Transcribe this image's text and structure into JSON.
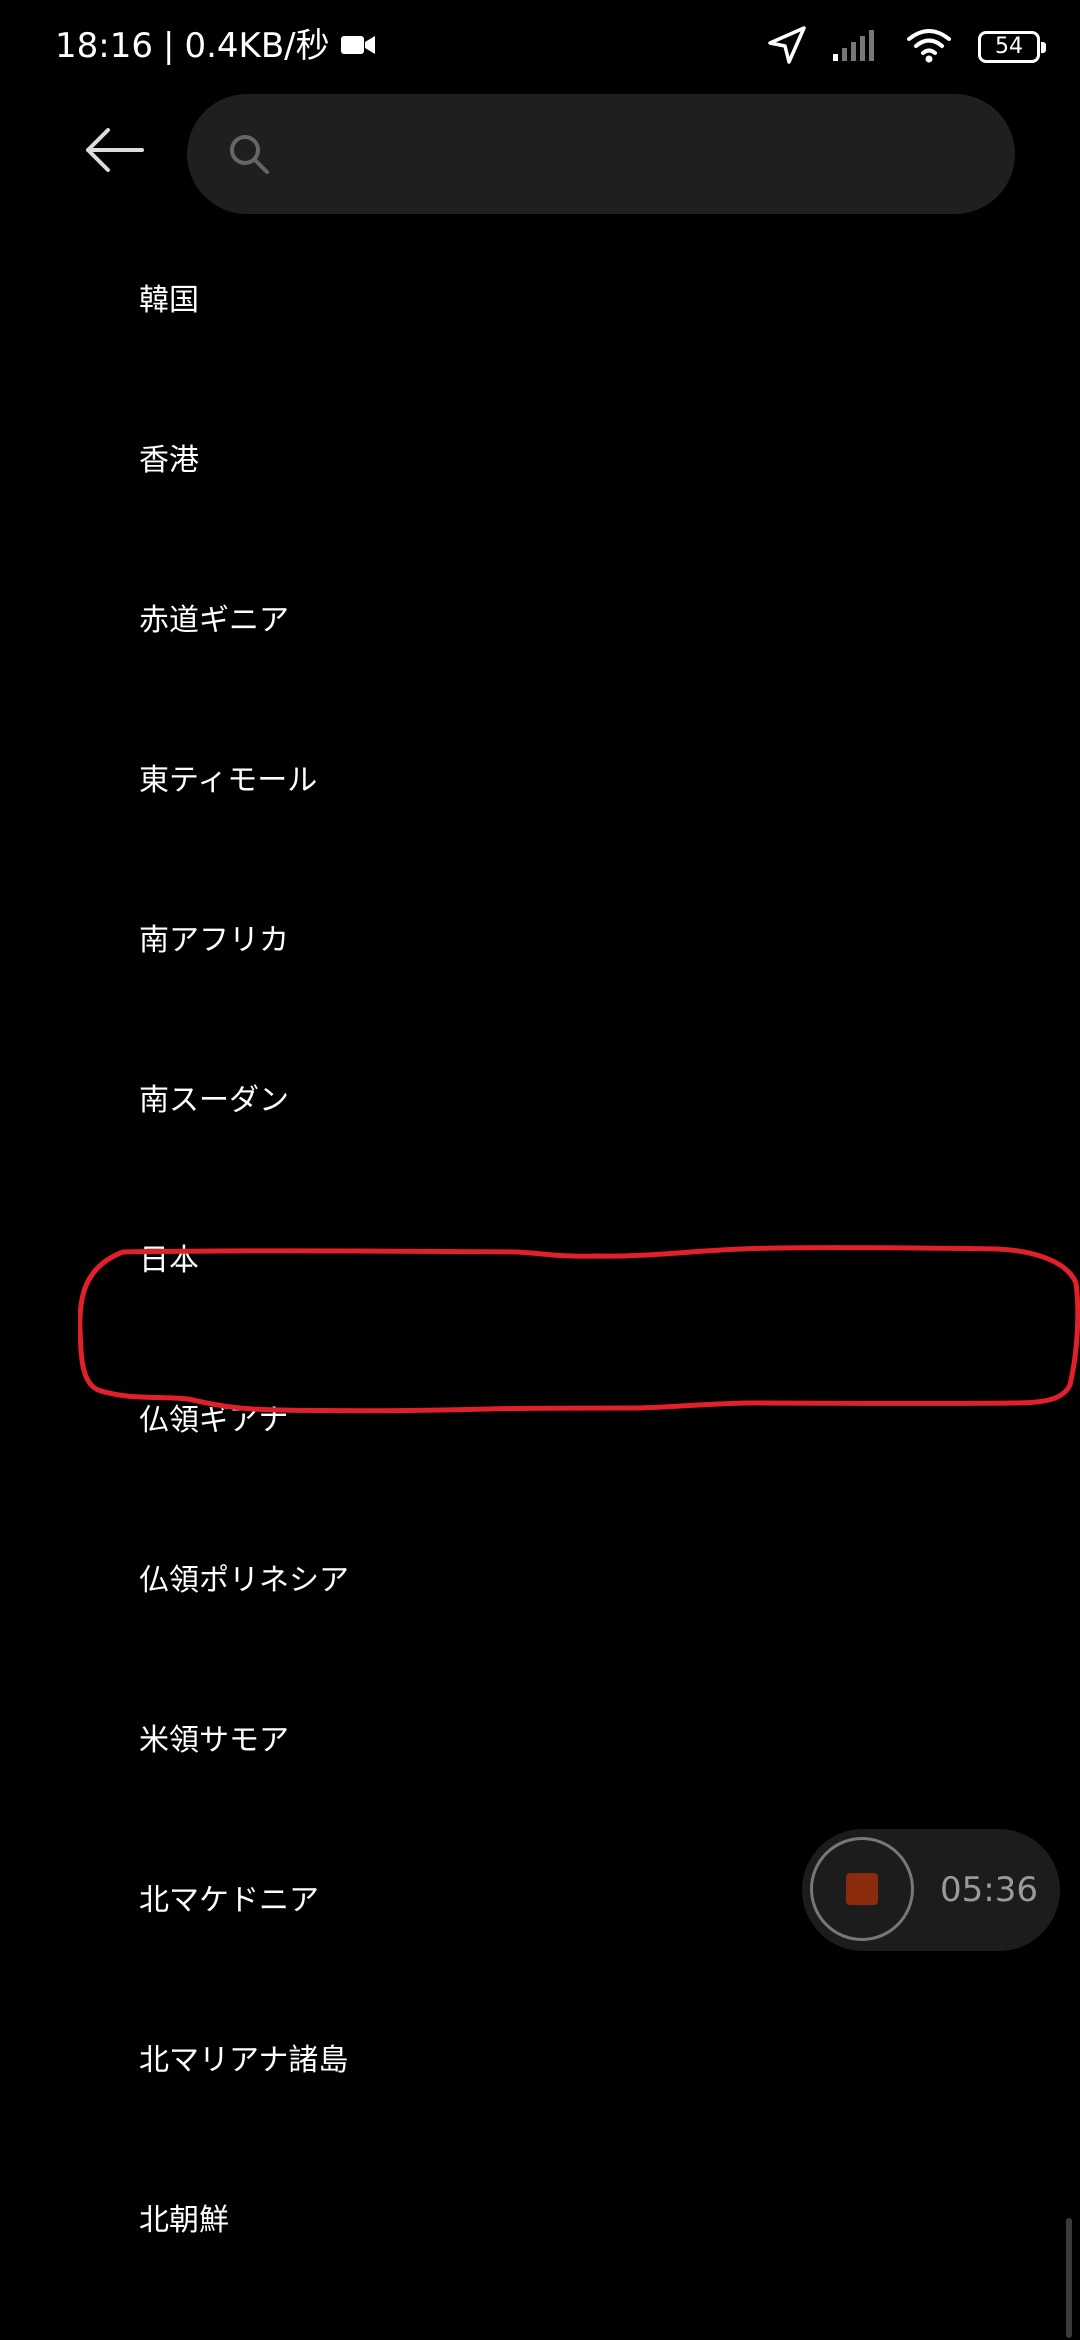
{
  "status_bar": {
    "time": "18:16",
    "separator": "|",
    "speed": "0.4KB/秒",
    "battery": "54",
    "icons": [
      "camera-icon",
      "location-arrow-icon",
      "signal-icon",
      "wifi-icon",
      "battery-icon"
    ]
  },
  "header": {
    "back_icon": "back-arrow-icon",
    "search_icon": "search-icon",
    "search_value": "",
    "search_placeholder": ""
  },
  "list": {
    "items": [
      "韓国",
      "香港",
      "赤道ギニア",
      "東ティモール",
      "南アフリカ",
      "南スーダン",
      "日本",
      "仏領ギアナ",
      "仏領ポリネシア",
      "米領サモア",
      "北マケドニア",
      "北マリアナ諸島",
      "北朝鮮"
    ]
  },
  "annotation": {
    "highlighted_item": "日本",
    "color": "#e0202a"
  },
  "recorder": {
    "elapsed": "05:36",
    "stop_color": "#8a2b0e"
  }
}
